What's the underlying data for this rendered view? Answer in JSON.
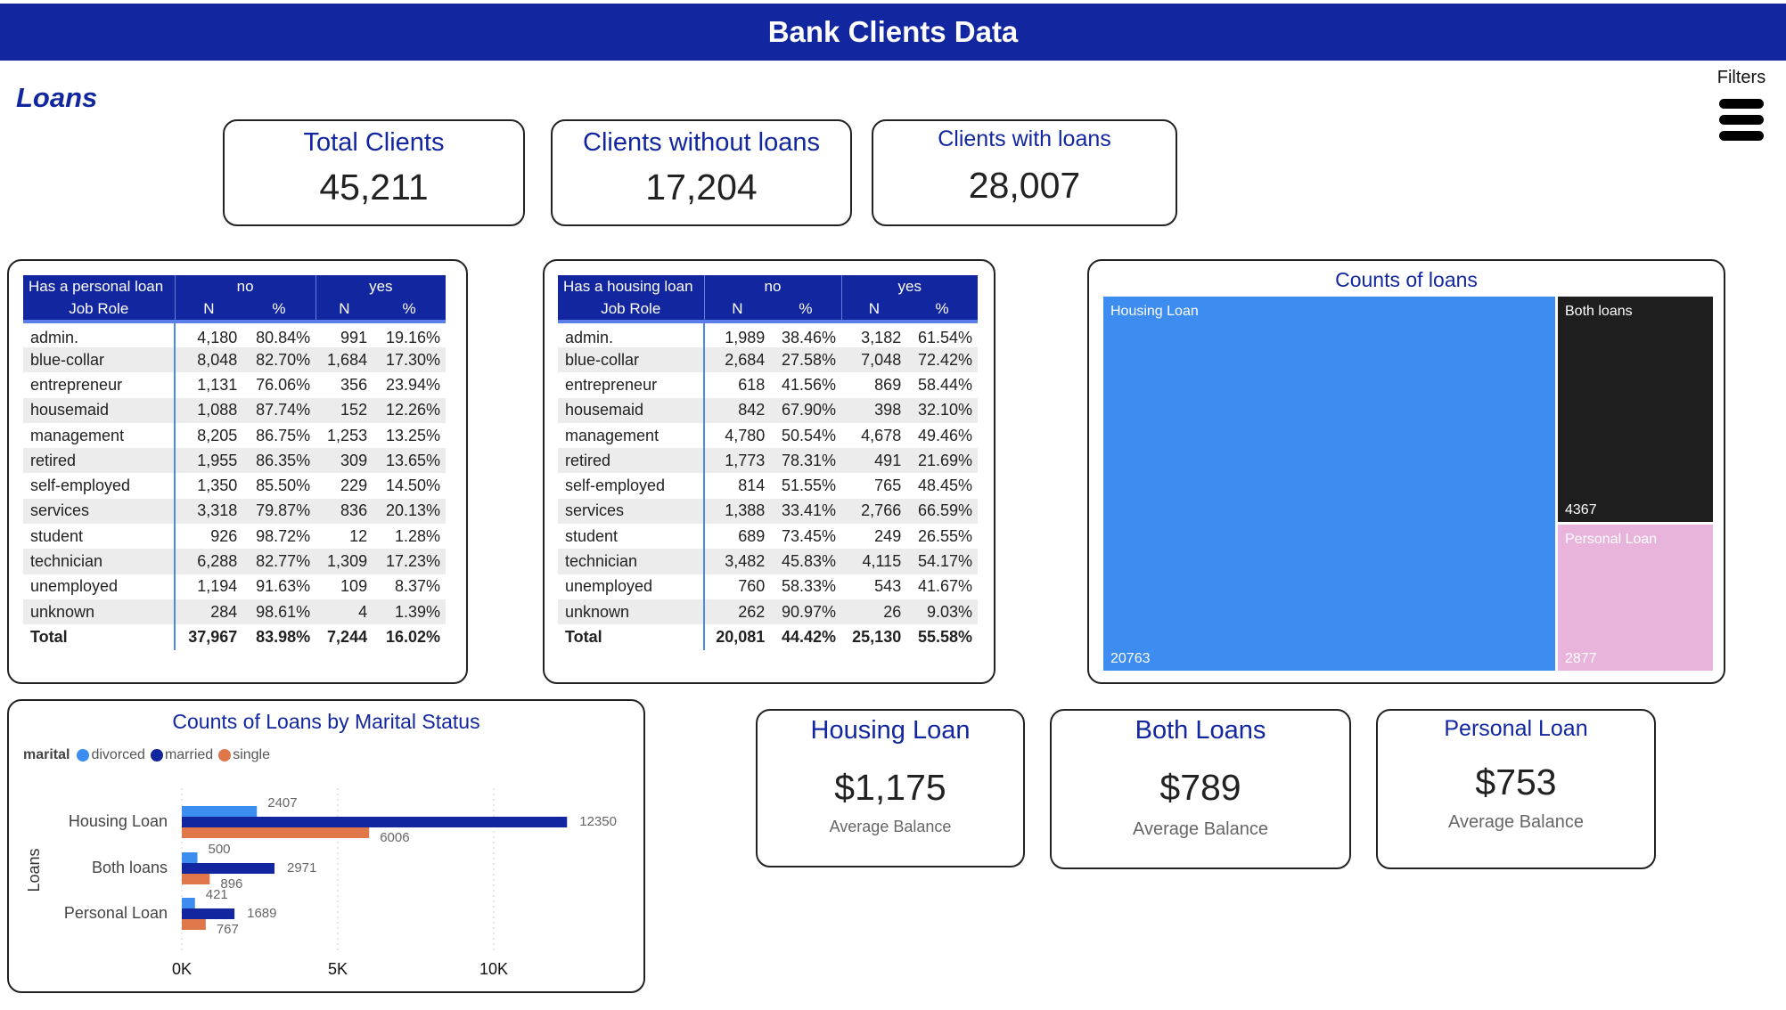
{
  "header": {
    "title": "Bank Clients Data"
  },
  "page": {
    "title": "Loans",
    "filters_label": "Filters"
  },
  "kpis": [
    {
      "title": "Total Clients",
      "value": "45,211"
    },
    {
      "title": "Clients without loans",
      "value": "17,204"
    },
    {
      "title": "Clients with loans",
      "value": "28,007"
    }
  ],
  "personal_table": {
    "corner": "Has a personal loan",
    "group_no": "no",
    "group_yes": "yes",
    "row_header": "Job Role",
    "col_n": "N",
    "col_pct": "%",
    "rows": [
      [
        "admin.",
        "4,180",
        "80.84%",
        "991",
        "19.16%"
      ],
      [
        "blue-collar",
        "8,048",
        "82.70%",
        "1,684",
        "17.30%"
      ],
      [
        "entrepreneur",
        "1,131",
        "76.06%",
        "356",
        "23.94%"
      ],
      [
        "housemaid",
        "1,088",
        "87.74%",
        "152",
        "12.26%"
      ],
      [
        "management",
        "8,205",
        "86.75%",
        "1,253",
        "13.25%"
      ],
      [
        "retired",
        "1,955",
        "86.35%",
        "309",
        "13.65%"
      ],
      [
        "self-employed",
        "1,350",
        "85.50%",
        "229",
        "14.50%"
      ],
      [
        "services",
        "3,318",
        "79.87%",
        "836",
        "20.13%"
      ],
      [
        "student",
        "926",
        "98.72%",
        "12",
        "1.28%"
      ],
      [
        "technician",
        "6,288",
        "82.77%",
        "1,309",
        "17.23%"
      ],
      [
        "unemployed",
        "1,194",
        "91.63%",
        "109",
        "8.37%"
      ],
      [
        "unknown",
        "284",
        "98.61%",
        "4",
        "1.39%"
      ]
    ],
    "total": [
      "Total",
      "37,967",
      "83.98%",
      "7,244",
      "16.02%"
    ]
  },
  "housing_table": {
    "corner": "Has a housing loan",
    "group_no": "no",
    "group_yes": "yes",
    "row_header": "Job Role",
    "col_n": "N",
    "col_pct": "%",
    "rows": [
      [
        "admin.",
        "1,989",
        "38.46%",
        "3,182",
        "61.54%"
      ],
      [
        "blue-collar",
        "2,684",
        "27.58%",
        "7,048",
        "72.42%"
      ],
      [
        "entrepreneur",
        "618",
        "41.56%",
        "869",
        "58.44%"
      ],
      [
        "housemaid",
        "842",
        "67.90%",
        "398",
        "32.10%"
      ],
      [
        "management",
        "4,780",
        "50.54%",
        "4,678",
        "49.46%"
      ],
      [
        "retired",
        "1,773",
        "78.31%",
        "491",
        "21.69%"
      ],
      [
        "self-employed",
        "814",
        "51.55%",
        "765",
        "48.45%"
      ],
      [
        "services",
        "1,388",
        "33.41%",
        "2,766",
        "66.59%"
      ],
      [
        "student",
        "689",
        "73.45%",
        "249",
        "26.55%"
      ],
      [
        "technician",
        "3,482",
        "45.83%",
        "4,115",
        "54.17%"
      ],
      [
        "unemployed",
        "760",
        "58.33%",
        "543",
        "41.67%"
      ],
      [
        "unknown",
        "262",
        "90.97%",
        "26",
        "9.03%"
      ]
    ],
    "total": [
      "Total",
      "20,081",
      "44.42%",
      "25,130",
      "55.58%"
    ]
  },
  "chart_data": [
    {
      "type": "treemap",
      "title": "Counts of loans",
      "items": [
        {
          "label": "Housing Loan",
          "value": 20763,
          "color": "#3d8cf0"
        },
        {
          "label": "Both loans",
          "value": 4367,
          "color": "#1e1e1e"
        },
        {
          "label": "Personal Loan",
          "value": 2877,
          "color": "#e8b4dc"
        }
      ]
    },
    {
      "type": "bar",
      "orientation": "horizontal",
      "title": "Counts of Loans by Marital Status",
      "legend_title": "marital",
      "ylabel": "Loans",
      "categories": [
        "Housing Loan",
        "Both loans",
        "Personal Loan"
      ],
      "series": [
        {
          "name": "divorced",
          "color": "#3d8cf0",
          "values": [
            2407,
            500,
            421
          ]
        },
        {
          "name": "married",
          "color": "#1226a0",
          "values": [
            12350,
            2971,
            1689
          ]
        },
        {
          "name": "single",
          "color": "#e0774a",
          "values": [
            6006,
            896,
            767
          ]
        }
      ],
      "xticks": [
        "0K",
        "5K",
        "10K"
      ],
      "xtick_values": [
        0,
        5000,
        10000
      ],
      "xlim": [
        0,
        13500
      ]
    }
  ],
  "avg_cards": [
    {
      "title": "Housing Loan",
      "value": "$1,175",
      "sub": "Average Balance"
    },
    {
      "title": "Both Loans",
      "value": "$789",
      "sub": "Average Balance"
    },
    {
      "title": "Personal Loan",
      "value": "$753",
      "sub": "Average Balance"
    }
  ]
}
